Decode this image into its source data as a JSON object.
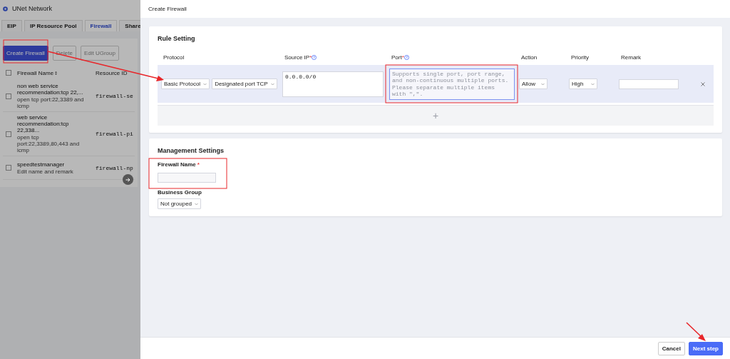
{
  "background_page": {
    "title": "UNet Network",
    "tabs": [
      {
        "label": "EIP",
        "selected": false
      },
      {
        "label": "IP Resource Pool",
        "selected": false
      },
      {
        "label": "Firewall",
        "selected": true
      },
      {
        "label": "Share",
        "selected": false
      }
    ],
    "toolbar": [
      {
        "label": "Create Firewall",
        "kind": "primary",
        "disabled": false
      },
      {
        "label": "Delete",
        "kind": "default",
        "disabled": true
      },
      {
        "label": "Edit UGroup",
        "kind": "default",
        "disabled": true
      }
    ],
    "table": {
      "select_all_checked": false,
      "columns": [
        "Firewall Name",
        "Resource ID"
      ],
      "rows": [
        {
          "checked": false,
          "name": "non web service recommendation:tcp 22,...",
          "remark": "open tcp port:22,3389 and icmp",
          "resource_id": "firewall-se"
        },
        {
          "checked": false,
          "name": "web service recommendation:tcp 22,338...",
          "remark": "open tcp port:22,3389,80,443 and icmp",
          "resource_id": "firewall-pi"
        },
        {
          "checked": false,
          "name": "speedtestmanager",
          "remark": "Edit name and remark",
          "resource_id": "firewall-np"
        }
      ]
    }
  },
  "drawer": {
    "title": "Create Firewall",
    "rule_setting": {
      "title": "Rule Setting",
      "columns": [
        {
          "label": "Protocol",
          "help": false
        },
        {
          "label": "Source IP",
          "required_mark": "*",
          "help": true
        },
        {
          "label": "Port",
          "required_mark": "*",
          "help": true
        },
        {
          "label": "Action",
          "help": false
        },
        {
          "label": "Priority",
          "help": false
        },
        {
          "label": "Remark",
          "help": false
        }
      ],
      "rules": [
        {
          "protocol": "Basic Protocol",
          "port_type": "Designated port TCP",
          "source_ip": "0.0.0.0/0",
          "port_placeholder": "Supports single port, port range, and non-continuous multiple ports. Please separate multiple items with \",\".",
          "port_focused": true,
          "action": "Allow",
          "priority": "High"
        }
      ],
      "add_label": "+"
    },
    "management": {
      "title": "Management Settings",
      "firewall_name_label": "Firewall Name",
      "firewall_name_required_mark": "*",
      "business_group_label": "Business Group",
      "business_group": "Not grouped"
    },
    "footer": [
      {
        "label": "Cancel",
        "kind": "default"
      },
      {
        "label": "Next step",
        "kind": "primary"
      }
    ]
  }
}
